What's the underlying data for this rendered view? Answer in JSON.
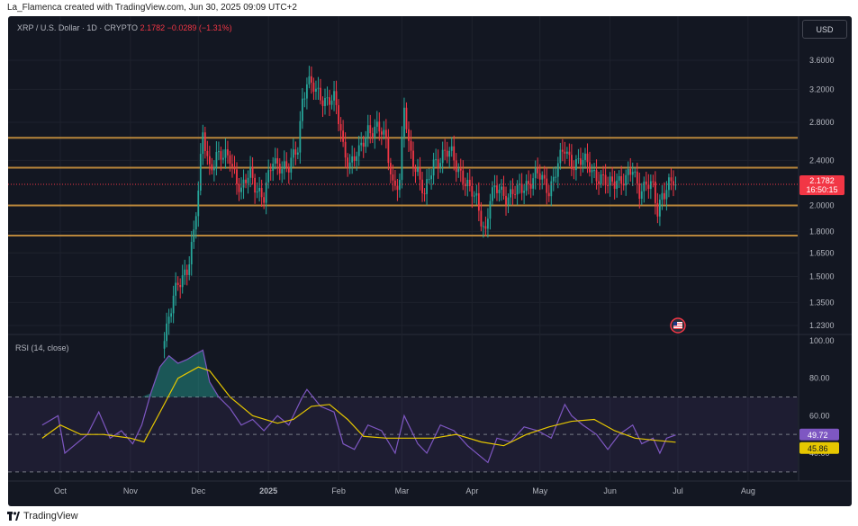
{
  "credit": "La_Flamenca created with TradingView.com, Jun 30, 2025 09:09 UTC+2",
  "symbol": {
    "name": "XRP / U.S. Dollar · 1D · CRYPTO",
    "price": "2.1782",
    "change": "−0.0289 (−1.31%)"
  },
  "currency_button": "USD",
  "footer_brand": "TradingView",
  "rsi_title": "RSI (14, close)",
  "price_label": {
    "value": "2.1782",
    "countdown": "16:50:15"
  },
  "rsi_labels": {
    "rsi": "49.72",
    "ma": "45.86"
  },
  "colors": {
    "up": "#26a69a",
    "down": "#f23645",
    "level_line": "#b8863b",
    "rsi_line": "#7e57c2",
    "rsi_ma": "#e6c700",
    "background": "#131722"
  },
  "chart_data": [
    {
      "type": "candlestick",
      "title": "XRP / U.S. Dollar · 1D · CRYPTO",
      "scale": "log",
      "y_ticks": [
        "3.6000",
        "3.2000",
        "2.8000",
        "2.4000",
        "2.0000",
        "1.8000",
        "1.6500",
        "1.5000",
        "1.3500",
        "1.2300"
      ],
      "y_tick_values": [
        3.6,
        3.2,
        2.8,
        2.4,
        2.0,
        1.8,
        1.65,
        1.5,
        1.35,
        1.23
      ],
      "x_ticks": [
        "Oct",
        "Nov",
        "Dec",
        "2025",
        "Feb",
        "Mar",
        "Apr",
        "May",
        "Jun",
        "Jul",
        "Aug"
      ],
      "x_tick_dates": [
        "2024-10-01",
        "2024-11-01",
        "2024-12-01",
        "2025-01-01",
        "2025-02-01",
        "2025-03-01",
        "2025-04-01",
        "2025-05-01",
        "2025-06-01",
        "2025-07-01",
        "2025-08-01"
      ],
      "horizontal_levels": [
        2.63,
        2.33,
        2.0,
        1.77
      ],
      "last_price": 2.1782,
      "anchors": [
        {
          "date": "2024-11-15",
          "close": 1.15
        },
        {
          "date": "2024-11-20",
          "close": 1.38
        },
        {
          "date": "2024-11-23",
          "close": 1.45
        },
        {
          "date": "2024-11-26",
          "close": 1.56
        },
        {
          "date": "2024-11-29",
          "close": 1.8
        },
        {
          "date": "2024-12-01",
          "close": 2.1
        },
        {
          "date": "2024-12-03",
          "close": 2.65
        },
        {
          "date": "2024-12-06",
          "close": 2.35
        },
        {
          "date": "2024-12-09",
          "close": 2.45
        },
        {
          "date": "2024-12-12",
          "close": 2.4
        },
        {
          "date": "2024-12-15",
          "close": 2.45
        },
        {
          "date": "2024-12-20",
          "close": 2.1
        },
        {
          "date": "2024-12-24",
          "close": 2.28
        },
        {
          "date": "2024-12-30",
          "close": 2.05
        },
        {
          "date": "2025-01-03",
          "close": 2.4
        },
        {
          "date": "2025-01-06",
          "close": 2.38
        },
        {
          "date": "2025-01-10",
          "close": 2.3
        },
        {
          "date": "2025-01-14",
          "close": 2.55
        },
        {
          "date": "2025-01-16",
          "close": 3.1
        },
        {
          "date": "2025-01-18",
          "close": 3.3
        },
        {
          "date": "2025-01-22",
          "close": 3.15
        },
        {
          "date": "2025-01-26",
          "close": 3.1
        },
        {
          "date": "2025-01-30",
          "close": 3.05
        },
        {
          "date": "2025-02-02",
          "close": 2.7
        },
        {
          "date": "2025-02-03",
          "close": 2.55
        },
        {
          "date": "2025-02-06",
          "close": 2.38
        },
        {
          "date": "2025-02-10",
          "close": 2.45
        },
        {
          "date": "2025-02-14",
          "close": 2.75
        },
        {
          "date": "2025-02-18",
          "close": 2.72
        },
        {
          "date": "2025-02-22",
          "close": 2.6
        },
        {
          "date": "2025-02-25",
          "close": 2.2
        },
        {
          "date": "2025-02-28",
          "close": 2.18
        },
        {
          "date": "2025-03-02",
          "close": 2.95
        },
        {
          "date": "2025-03-04",
          "close": 2.55
        },
        {
          "date": "2025-03-08",
          "close": 2.3
        },
        {
          "date": "2025-03-11",
          "close": 2.05
        },
        {
          "date": "2025-03-15",
          "close": 2.4
        },
        {
          "date": "2025-03-19",
          "close": 2.45
        },
        {
          "date": "2025-03-23",
          "close": 2.45
        },
        {
          "date": "2025-03-27",
          "close": 2.3
        },
        {
          "date": "2025-03-31",
          "close": 2.1
        },
        {
          "date": "2025-04-03",
          "close": 2.05
        },
        {
          "date": "2025-04-07",
          "close": 1.8
        },
        {
          "date": "2025-04-09",
          "close": 2.05
        },
        {
          "date": "2025-04-13",
          "close": 2.15
        },
        {
          "date": "2025-04-17",
          "close": 2.08
        },
        {
          "date": "2025-04-21",
          "close": 2.1
        },
        {
          "date": "2025-04-25",
          "close": 2.2
        },
        {
          "date": "2025-04-30",
          "close": 2.25
        },
        {
          "date": "2025-05-05",
          "close": 2.15
        },
        {
          "date": "2025-05-09",
          "close": 2.35
        },
        {
          "date": "2025-05-12",
          "close": 2.5
        },
        {
          "date": "2025-05-15",
          "close": 2.4
        },
        {
          "date": "2025-05-19",
          "close": 2.38
        },
        {
          "date": "2025-05-23",
          "close": 2.35
        },
        {
          "date": "2025-05-27",
          "close": 2.25
        },
        {
          "date": "2025-05-31",
          "close": 2.15
        },
        {
          "date": "2025-06-04",
          "close": 2.25
        },
        {
          "date": "2025-06-08",
          "close": 2.2
        },
        {
          "date": "2025-06-11",
          "close": 2.3
        },
        {
          "date": "2025-06-14",
          "close": 2.15
        },
        {
          "date": "2025-06-17",
          "close": 2.18
        },
        {
          "date": "2025-06-20",
          "close": 2.12
        },
        {
          "date": "2025-06-22",
          "close": 1.95
        },
        {
          "date": "2025-06-24",
          "close": 2.12
        },
        {
          "date": "2025-06-27",
          "close": 2.18
        },
        {
          "date": "2025-06-30",
          "close": 2.1782
        }
      ]
    },
    {
      "type": "line",
      "title": "RSI (14, close)",
      "ylim": [
        0,
        100
      ],
      "y_ticks": [
        "100.00",
        "80.00",
        "60.00",
        "40.00"
      ],
      "y_tick_values": [
        100,
        80,
        60,
        40
      ],
      "bands": {
        "upper": 70,
        "middle": 50,
        "lower": 30
      },
      "series": [
        {
          "name": "RSI",
          "points": [
            {
              "date": "2024-09-23",
              "value": 55
            },
            {
              "date": "2024-09-30",
              "value": 60
            },
            {
              "date": "2024-10-03",
              "value": 40
            },
            {
              "date": "2024-10-08",
              "value": 45
            },
            {
              "date": "2024-10-13",
              "value": 50
            },
            {
              "date": "2024-10-18",
              "value": 62
            },
            {
              "date": "2024-10-23",
              "value": 48
            },
            {
              "date": "2024-10-28",
              "value": 52
            },
            {
              "date": "2024-11-02",
              "value": 45
            },
            {
              "date": "2024-11-06",
              "value": 55
            },
            {
              "date": "2024-11-10",
              "value": 72
            },
            {
              "date": "2024-11-14",
              "value": 86
            },
            {
              "date": "2024-11-18",
              "value": 92
            },
            {
              "date": "2024-11-22",
              "value": 88
            },
            {
              "date": "2024-11-26",
              "value": 90
            },
            {
              "date": "2024-11-30",
              "value": 93
            },
            {
              "date": "2024-12-03",
              "value": 95
            },
            {
              "date": "2024-12-06",
              "value": 78
            },
            {
              "date": "2024-12-10",
              "value": 70
            },
            {
              "date": "2024-12-15",
              "value": 64
            },
            {
              "date": "2024-12-20",
              "value": 55
            },
            {
              "date": "2024-12-25",
              "value": 58
            },
            {
              "date": "2024-12-30",
              "value": 52
            },
            {
              "date": "2025-01-05",
              "value": 60
            },
            {
              "date": "2025-01-10",
              "value": 55
            },
            {
              "date": "2025-01-16",
              "value": 70
            },
            {
              "date": "2025-01-18",
              "value": 74
            },
            {
              "date": "2025-01-24",
              "value": 65
            },
            {
              "date": "2025-01-30",
              "value": 62
            },
            {
              "date": "2025-02-03",
              "value": 45
            },
            {
              "date": "2025-02-08",
              "value": 42
            },
            {
              "date": "2025-02-14",
              "value": 55
            },
            {
              "date": "2025-02-20",
              "value": 52
            },
            {
              "date": "2025-02-26",
              "value": 40
            },
            {
              "date": "2025-03-02",
              "value": 60
            },
            {
              "date": "2025-03-08",
              "value": 45
            },
            {
              "date": "2025-03-12",
              "value": 40
            },
            {
              "date": "2025-03-18",
              "value": 55
            },
            {
              "date": "2025-03-24",
              "value": 52
            },
            {
              "date": "2025-03-30",
              "value": 44
            },
            {
              "date": "2025-04-05",
              "value": 38
            },
            {
              "date": "2025-04-08",
              "value": 35
            },
            {
              "date": "2025-04-12",
              "value": 48
            },
            {
              "date": "2025-04-18",
              "value": 46
            },
            {
              "date": "2025-04-24",
              "value": 54
            },
            {
              "date": "2025-04-30",
              "value": 52
            },
            {
              "date": "2025-05-06",
              "value": 48
            },
            {
              "date": "2025-05-12",
              "value": 66
            },
            {
              "date": "2025-05-15",
              "value": 60
            },
            {
              "date": "2025-05-20",
              "value": 55
            },
            {
              "date": "2025-05-26",
              "value": 50
            },
            {
              "date": "2025-05-31",
              "value": 42
            },
            {
              "date": "2025-06-05",
              "value": 50
            },
            {
              "date": "2025-06-11",
              "value": 55
            },
            {
              "date": "2025-06-15",
              "value": 45
            },
            {
              "date": "2025-06-20",
              "value": 48
            },
            {
              "date": "2025-06-23",
              "value": 40
            },
            {
              "date": "2025-06-26",
              "value": 48
            },
            {
              "date": "2025-06-30",
              "value": 49.72
            }
          ]
        },
        {
          "name": "RSI-based MA",
          "points": [
            {
              "date": "2024-09-23",
              "value": 48
            },
            {
              "date": "2024-10-01",
              "value": 55
            },
            {
              "date": "2024-10-10",
              "value": 50
            },
            {
              "date": "2024-10-20",
              "value": 50
            },
            {
              "date": "2024-11-01",
              "value": 48
            },
            {
              "date": "2024-11-07",
              "value": 46
            },
            {
              "date": "2024-11-15",
              "value": 64
            },
            {
              "date": "2024-11-22",
              "value": 80
            },
            {
              "date": "2024-12-01",
              "value": 86
            },
            {
              "date": "2024-12-06",
              "value": 84
            },
            {
              "date": "2024-12-15",
              "value": 70
            },
            {
              "date": "2024-12-25",
              "value": 60
            },
            {
              "date": "2025-01-05",
              "value": 56
            },
            {
              "date": "2025-01-12",
              "value": 58
            },
            {
              "date": "2025-01-20",
              "value": 65
            },
            {
              "date": "2025-01-28",
              "value": 66
            },
            {
              "date": "2025-02-05",
              "value": 58
            },
            {
              "date": "2025-02-12",
              "value": 49
            },
            {
              "date": "2025-02-22",
              "value": 48
            },
            {
              "date": "2025-03-05",
              "value": 48
            },
            {
              "date": "2025-03-15",
              "value": 48
            },
            {
              "date": "2025-03-25",
              "value": 50
            },
            {
              "date": "2025-04-05",
              "value": 46
            },
            {
              "date": "2025-04-15",
              "value": 44
            },
            {
              "date": "2025-04-25",
              "value": 50
            },
            {
              "date": "2025-05-05",
              "value": 54
            },
            {
              "date": "2025-05-15",
              "value": 57
            },
            {
              "date": "2025-05-25",
              "value": 58
            },
            {
              "date": "2025-06-03",
              "value": 52
            },
            {
              "date": "2025-06-12",
              "value": 48
            },
            {
              "date": "2025-06-20",
              "value": 47
            },
            {
              "date": "2025-06-30",
              "value": 45.86
            }
          ]
        }
      ]
    }
  ]
}
